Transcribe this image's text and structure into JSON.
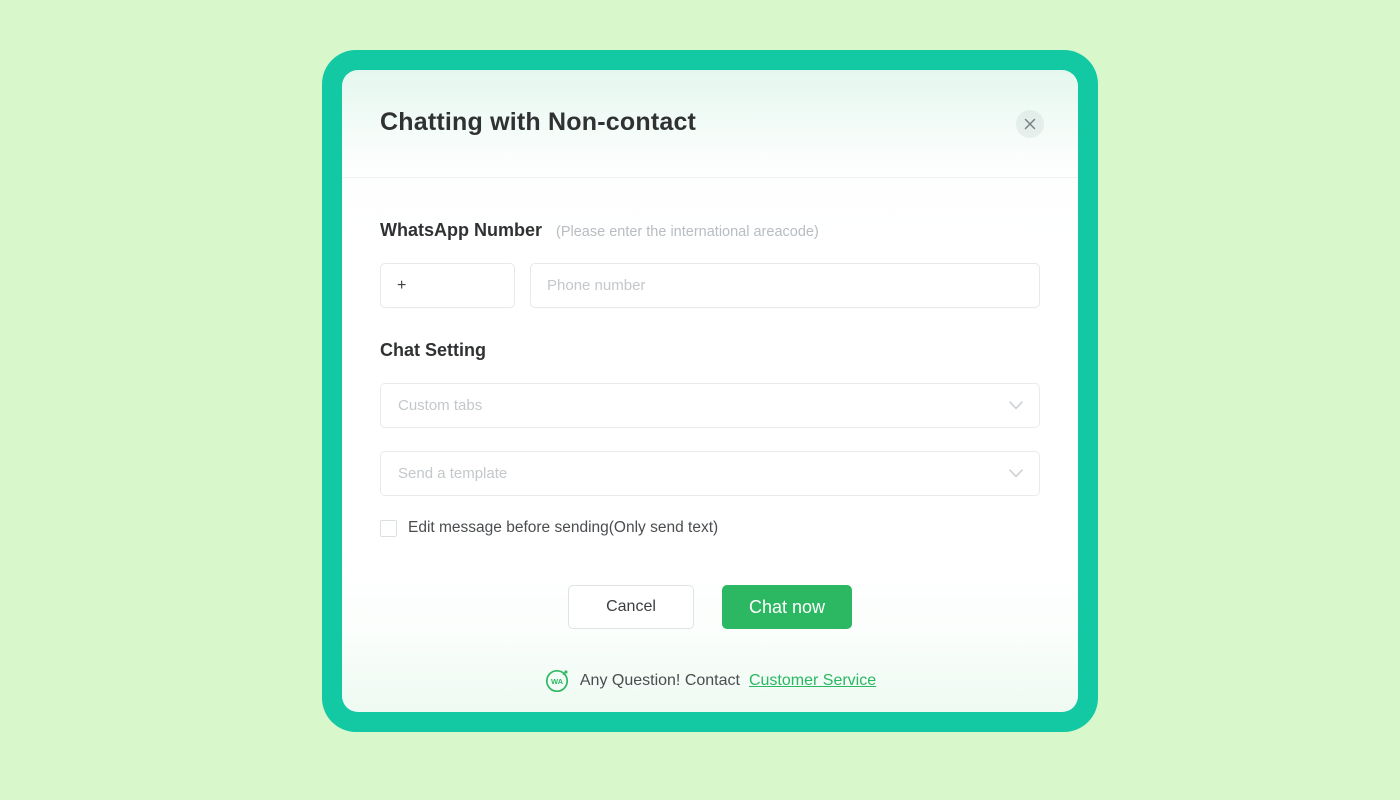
{
  "theme": {
    "page_background": "#d8f8cb",
    "frame_color": "#12c9a4",
    "primary_green": "#2cb862",
    "link_green": "#2cb862"
  },
  "dialog": {
    "title": "Chatting with Non-contact",
    "close_icon": "close-icon"
  },
  "whatsapp_number": {
    "label": "WhatsApp Number",
    "hint": "(Please enter the international areacode)",
    "country_code_value": "+",
    "country_code_placeholder": "+",
    "phone_placeholder": "Phone number",
    "phone_value": ""
  },
  "chat_setting": {
    "title": "Chat Setting",
    "tabs_select": {
      "placeholder": "Custom tabs",
      "value": "",
      "icon": "chevron-down-icon"
    },
    "template_select": {
      "placeholder": "Send a template",
      "value": "",
      "icon": "chevron-down-icon"
    },
    "edit_checkbox": {
      "label": "Edit message before sending(Only send text)",
      "checked": false
    }
  },
  "actions": {
    "cancel_label": "Cancel",
    "primary_label": "Chat now"
  },
  "footer": {
    "logo_text": "WA",
    "logo_icon": "whatsapp-assistant-logo-icon",
    "text": "Any Question! Contact",
    "link_label": "Customer Service"
  }
}
